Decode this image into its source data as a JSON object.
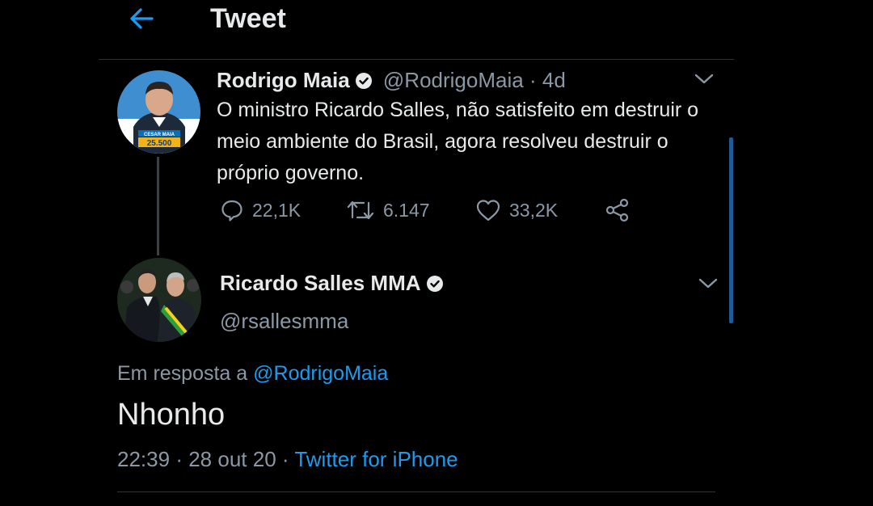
{
  "header": {
    "title": "Tweet"
  },
  "parent_tweet": {
    "name": "Rodrigo Maia",
    "handle": "@RodrigoMaia",
    "separator": "·",
    "age": "4d",
    "text": "O ministro Ricardo Salles, não satisfeito em destruir o meio ambiente do Brasil, agora resolveu destruir o próprio governo.",
    "replies": "22,1K",
    "retweets": "6.147",
    "likes": "33,2K",
    "avatar_text_1": "CESAR MAIA",
    "avatar_text_2": "25.500"
  },
  "main_tweet": {
    "name": "Ricardo Salles MMA",
    "handle": "@rsallesmma",
    "reply_prefix": "Em resposta a",
    "reply_to": "@RodrigoMaia",
    "text": "Nhonho",
    "time": "22:39",
    "dot1": "·",
    "date": "28 out 20",
    "dot2": "·",
    "source": "Twitter for iPhone"
  },
  "colors": {
    "accent": "#1d9bf0",
    "background": "#000000",
    "muted": "#8b98a5"
  },
  "icons": [
    "back-arrow-icon",
    "verified-badge-icon",
    "chevron-down-icon",
    "reply-icon",
    "retweet-icon",
    "like-icon",
    "share-icon"
  ]
}
